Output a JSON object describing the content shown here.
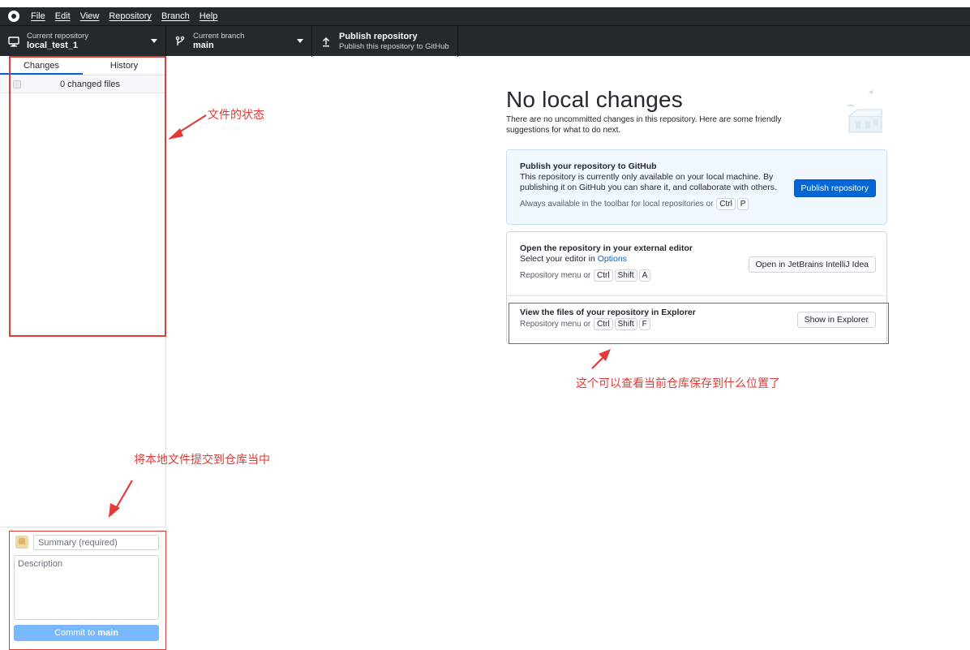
{
  "menubar": {
    "items": [
      "File",
      "Edit",
      "View",
      "Repository",
      "Branch",
      "Help"
    ]
  },
  "toolbar": {
    "repo": {
      "top_label": "Current repository",
      "main_label": "local_test_1"
    },
    "branch": {
      "top_label": "Current branch",
      "main_label": "main"
    },
    "publish": {
      "main_label": "Publish repository",
      "top_label": "Publish this repository to GitHub"
    }
  },
  "sidebar": {
    "tabs": [
      "Changes",
      "History"
    ],
    "active_tab": "Changes",
    "changed_files_label": "0 changed files",
    "commit": {
      "summary_placeholder": "Summary (required)",
      "description_placeholder": "Description",
      "button_prefix": "Commit to ",
      "button_branch": "main"
    }
  },
  "main": {
    "heading": "No local changes",
    "subtext": "There are no uncommitted changes in this repository. Here are some friendly suggestions for what to do next.",
    "publish_card": {
      "title": "Publish your repository to GitHub",
      "desc": "This repository is currently only available on your local machine. By publishing it on GitHub you can share it, and collaborate with others.",
      "note_prefix": "Always available in the toolbar for local repositories or",
      "shortcut": [
        "Ctrl",
        "P"
      ],
      "button": "Publish repository"
    },
    "editor_card": {
      "title": "Open the repository in your external editor",
      "desc_prefix": "Select your editor in ",
      "desc_link": "Options",
      "note_prefix": "Repository menu or",
      "shortcut": [
        "Ctrl",
        "Shift",
        "A"
      ],
      "button": "Open in JetBrains IntelliJ Idea"
    },
    "explorer_card": {
      "title": "View the files of your repository in Explorer",
      "note_prefix": "Repository menu or",
      "shortcut": [
        "Ctrl",
        "Shift",
        "F"
      ],
      "button": "Show in Explorer"
    }
  },
  "annotations": {
    "file_status": "文件的状态",
    "explorer_hint": "这个可以查看当前仓库保存到什么位置了",
    "commit_hint": "将本地文件提交到仓库当中"
  },
  "colors": {
    "toolbar_bg": "#24292e",
    "accent_blue": "#0366d6",
    "annotation_red": "#e53935"
  }
}
